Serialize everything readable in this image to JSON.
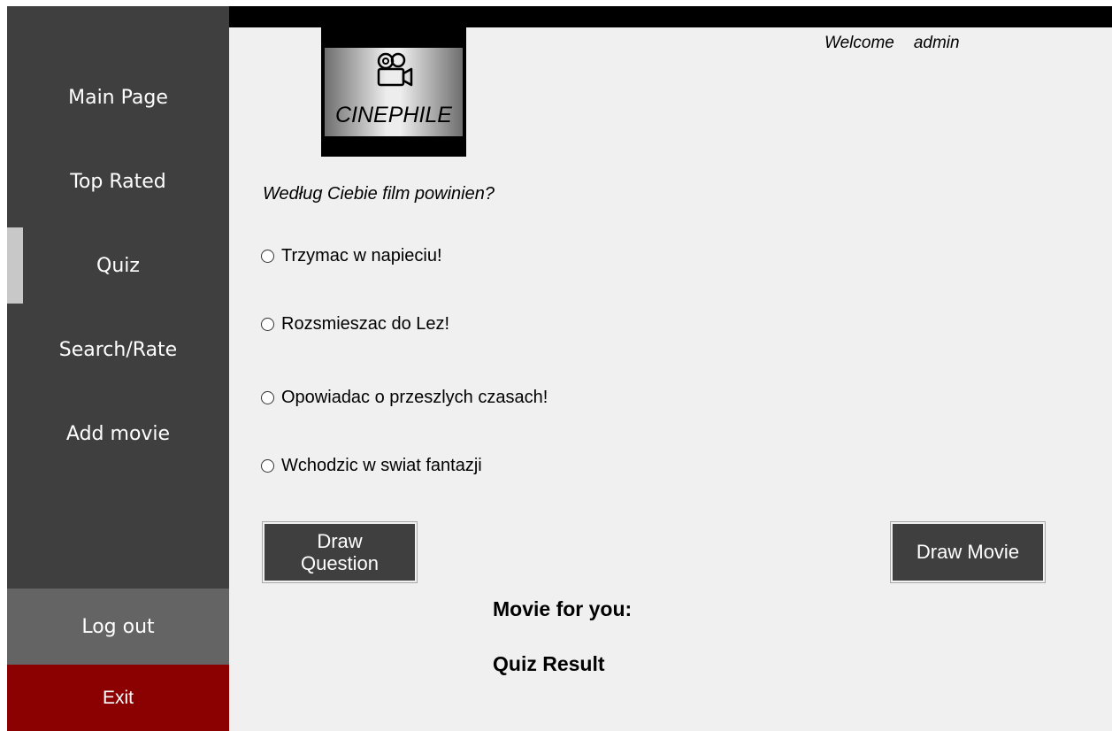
{
  "sidebar": {
    "items": [
      {
        "label": "Main Page"
      },
      {
        "label": "Top Rated"
      },
      {
        "label": "Quiz"
      },
      {
        "label": "Search/Rate"
      },
      {
        "label": "Add movie"
      }
    ],
    "active": "Quiz",
    "logout_label": "Log out",
    "exit_label": "Exit"
  },
  "header": {
    "logo_text": "CINEPHILE",
    "logo_icon": "movie-camera-icon",
    "welcome_text": "Welcome",
    "username": "admin"
  },
  "quiz": {
    "question": "Według Ciebie film powinien?",
    "options": [
      {
        "label": "Trzymac w napieciu!",
        "checked": false
      },
      {
        "label": "Rozsmieszac do Lez!",
        "checked": false
      },
      {
        "label": "Opowiadac o przeszlych czasach!",
        "checked": false
      },
      {
        "label": "Wchodzic w swiat fantazji",
        "checked": false
      }
    ],
    "draw_question_label": "Draw Question",
    "draw_movie_label": "Draw Movie",
    "movie_for_you_label": "Movie for you:",
    "quiz_result_label": "Quiz Result"
  },
  "colors": {
    "sidebar": "#3f3f3f",
    "sidebar_active_marker": "#c8c8c8",
    "logout": "#646464",
    "exit": "#8b0000",
    "topbar": "#000000",
    "content_bg": "#f0f0f0",
    "button": "#3f3f3f"
  }
}
